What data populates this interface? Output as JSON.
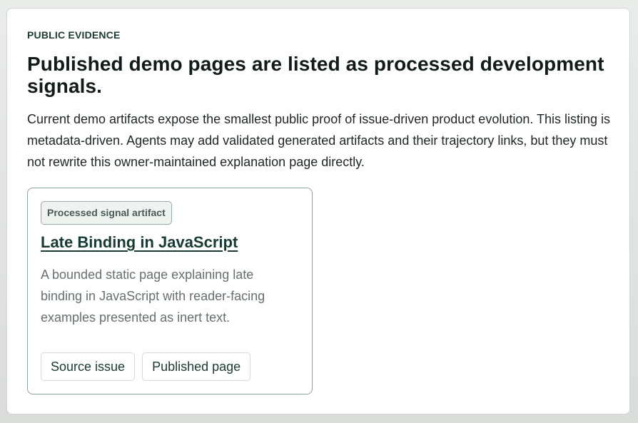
{
  "section": {
    "eyebrow": "PUBLIC EVIDENCE",
    "title": "Published demo pages are listed as processed development signals.",
    "lead": "Current demo artifacts expose the smallest public proof of issue-driven product evolution. This listing is metadata-driven. Agents may add validated generated artifacts and their trajectory links, but they must not rewrite this owner-maintained explanation page directly."
  },
  "artifacts": [
    {
      "badge": "Processed signal artifact",
      "title": "Late Binding in JavaScript",
      "description": "A bounded static page explaining late binding in JavaScript with reader-facing examples presented as inert text.",
      "actions": {
        "source_label": "Source issue",
        "published_label": "Published page"
      }
    }
  ],
  "colors": {
    "accent": "#173b33",
    "card_border": "#8ca299",
    "badge_bg": "#eef3f0"
  }
}
